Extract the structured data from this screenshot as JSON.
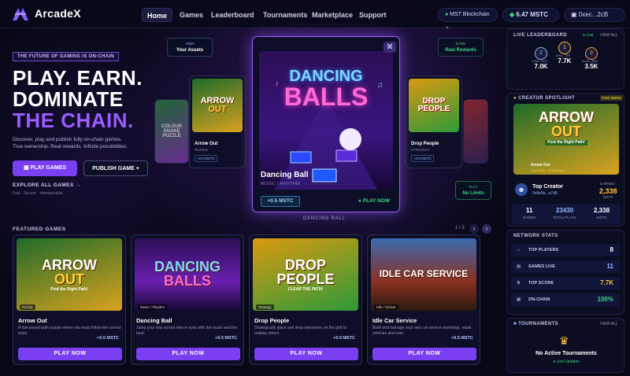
{
  "nav": {
    "brand": "ArcadeX",
    "links": [
      "Home",
      "Games",
      "Leaderboard",
      "Tournaments",
      "Marketplace",
      "Support"
    ],
    "chain": "MST Blockchain",
    "balance": "6.47 MSTC",
    "address": "0xec...2cB"
  },
  "hero": {
    "tag": "THE FUTURE OF GAMING IS ON-CHAIN",
    "line1": "PLAY. EARN.",
    "line2": "DOMINATE",
    "line3": "THE CHAIN.",
    "sub1": "Discover, play and publish fully on-chain games.",
    "sub2": "True ownership. Real rewards. Infinite possibilities.",
    "play_btn": "PLAY GAMES",
    "publish_btn": "PUBLISH GAME +",
    "explore": "EXPLORE ALL GAMES →",
    "explore_sub": "Fast · Secure · Interoperable"
  },
  "floats": {
    "own_small": "OWN",
    "own_big": "Your Assets",
    "earn_small": "EARN",
    "earn_big": "Real Rewards",
    "play_small": "PLAY",
    "play_big": "No Limits"
  },
  "carousel": {
    "center": {
      "art1": "DANCING",
      "art2": "BALLS",
      "title": "Dancing Ball",
      "genre": "MUSIC / RHYTHM",
      "reward": "+0.5 MSTC",
      "play": "PLAY NOW"
    },
    "caption": "DANCING BALL",
    "left": {
      "art1": "ARROW",
      "art2": "OUT",
      "title": "Arrow Out",
      "genre": "PUZZLE",
      "reward": "+0.5 MSTC"
    },
    "right": {
      "art1": "DROP",
      "art2": "PEOPLE",
      "title": "Drop People",
      "genre": "STRATEGY",
      "reward": "+0.5 MSTC"
    },
    "far_left": "COLOUR SNAKE PUZZLE"
  },
  "featured": {
    "label": "FEATURED GAMES",
    "page": "1 / 3",
    "games": [
      {
        "art1": "ARROW",
        "art2": "OUT",
        "art3": "Find the Right Path!",
        "tag": "Puzzle",
        "title": "Arrow Out",
        "desc": "A fast-paced path puzzle where you must follow the correct route.",
        "reward": "+0.5 MSTC",
        "btn": "PLAY NOW"
      },
      {
        "art1": "DANCING",
        "art2": "BALLS",
        "art3": "",
        "tag": "Music / Rhythm",
        "title": "Dancing Ball",
        "desc": "Jump your way across tiles in sync with the music and the beat.",
        "reward": "+0.5 MSTC",
        "btn": "PLAY NOW"
      },
      {
        "art1": "DROP",
        "art2": "PEOPLE",
        "art3": "CLEAR THE PATH!",
        "tag": "Strategy",
        "title": "Drop People",
        "desc": "Strategically place and drop characters on the grid to outplay others.",
        "reward": "+0.5 MSTC",
        "btn": "PLAY NOW"
      },
      {
        "art1": "IDLE CAR SERVICE",
        "art2": "",
        "art3": "",
        "tag": "Idle / Clicker",
        "title": "Idle Car Service",
        "desc": "Build and manage your own car service workshop, repair vehicles and earn.",
        "reward": "+0.5 MSTC",
        "btn": "PLAY NOW"
      }
    ]
  },
  "leaderboard": {
    "title": "LIVE LEADERBOARD",
    "live": "● Live",
    "view": "VIEW ALL",
    "entries": [
      {
        "rank": "2",
        "addr": "0x2a5...fe76",
        "score": "7.0K"
      },
      {
        "rank": "1",
        "addr": "0xfc4...799f",
        "score": "7.7K"
      },
      {
        "rank": "3",
        "addr": "0x1d4...59e0",
        "score": "3.5K"
      }
    ]
  },
  "spotlight": {
    "title": "CREATOR SPOTLIGHT",
    "badge": "THIS WEEK",
    "art1": "ARROW",
    "art2": "OUT",
    "art3": "Find the Right Path!",
    "game": "Arrow Out",
    "game_sub": "Top Game · 5,456 plays",
    "name": "Top Creator",
    "addr": "0x8e5b...a7d8",
    "earned_label": "EARNED",
    "earned": "2,338",
    "earned_unit": "MSTC",
    "games": "11",
    "games_l": "GAMES",
    "plays": "23430",
    "plays_l": "TOTAL PLAYS",
    "mstc": "2,338",
    "mstc_l": "MSTC"
  },
  "stats": {
    "title": "NETWORK STATS",
    "rows": [
      {
        "label": "TOP PLAYERS",
        "value": "8"
      },
      {
        "label": "GAMES LIVE",
        "value": "11"
      },
      {
        "label": "TOP SCORE",
        "value": "7.7K"
      },
      {
        "label": "ON-CHAIN",
        "value": "100%"
      }
    ]
  },
  "tournaments": {
    "title": "TOURNAMENTS",
    "view": "VIEW ALL",
    "empty": "No Active Tournaments",
    "live": "● Live Updates"
  },
  "colors": {
    "accent": "#7b3ff2",
    "green": "#37d77f",
    "gold": "#ffc53a"
  }
}
